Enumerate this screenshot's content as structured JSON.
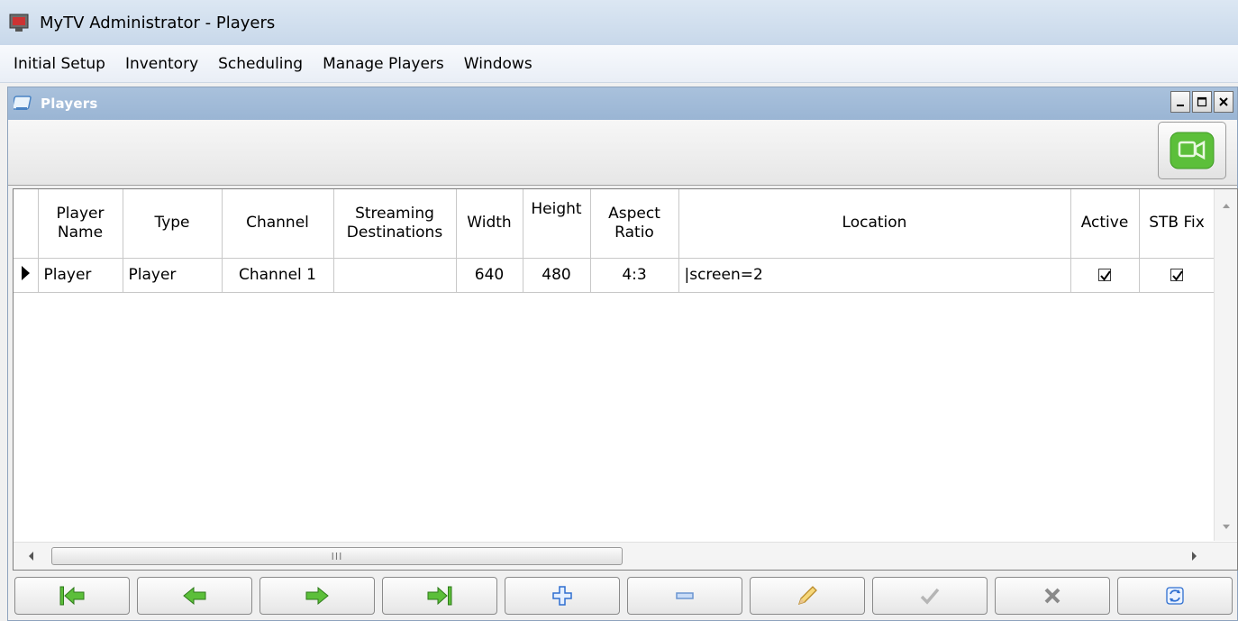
{
  "window": {
    "title": "MyTV Administrator - Players"
  },
  "menu": [
    {
      "label": "Initial Setup"
    },
    {
      "label": "Inventory"
    },
    {
      "label": "Scheduling"
    },
    {
      "label": "Manage Players"
    },
    {
      "label": "Windows"
    }
  ],
  "child_window": {
    "title": "Players"
  },
  "grid": {
    "columns": [
      "Player Name",
      "Type",
      "Channel",
      "Streaming Destinations",
      "Width",
      "Height",
      "Aspect Ratio",
      "Location",
      "Active",
      "STB Fix"
    ],
    "rows": [
      {
        "player_name": "Player",
        "type": "Player",
        "channel": "Channel 1",
        "streaming_destinations": "",
        "width": "640",
        "height": "480",
        "aspect_ratio": "4:3",
        "location": "|screen=2",
        "active": true,
        "stb_fix": true
      }
    ]
  },
  "scroll": {
    "thumb_glyph": "III"
  },
  "nav_buttons": [
    {
      "icon": "first-record-icon"
    },
    {
      "icon": "previous-record-icon"
    },
    {
      "icon": "next-record-icon"
    },
    {
      "icon": "last-record-icon"
    },
    {
      "icon": "add-icon"
    },
    {
      "icon": "delete-icon"
    },
    {
      "icon": "edit-pencil-icon"
    },
    {
      "icon": "checkmark-icon"
    },
    {
      "icon": "cancel-x-icon"
    },
    {
      "icon": "refresh-icon"
    }
  ],
  "colors": {
    "accent_green": "#5cbf3a",
    "title_blue": "#9ab5d4",
    "plus_blue": "#2f6fd0"
  }
}
